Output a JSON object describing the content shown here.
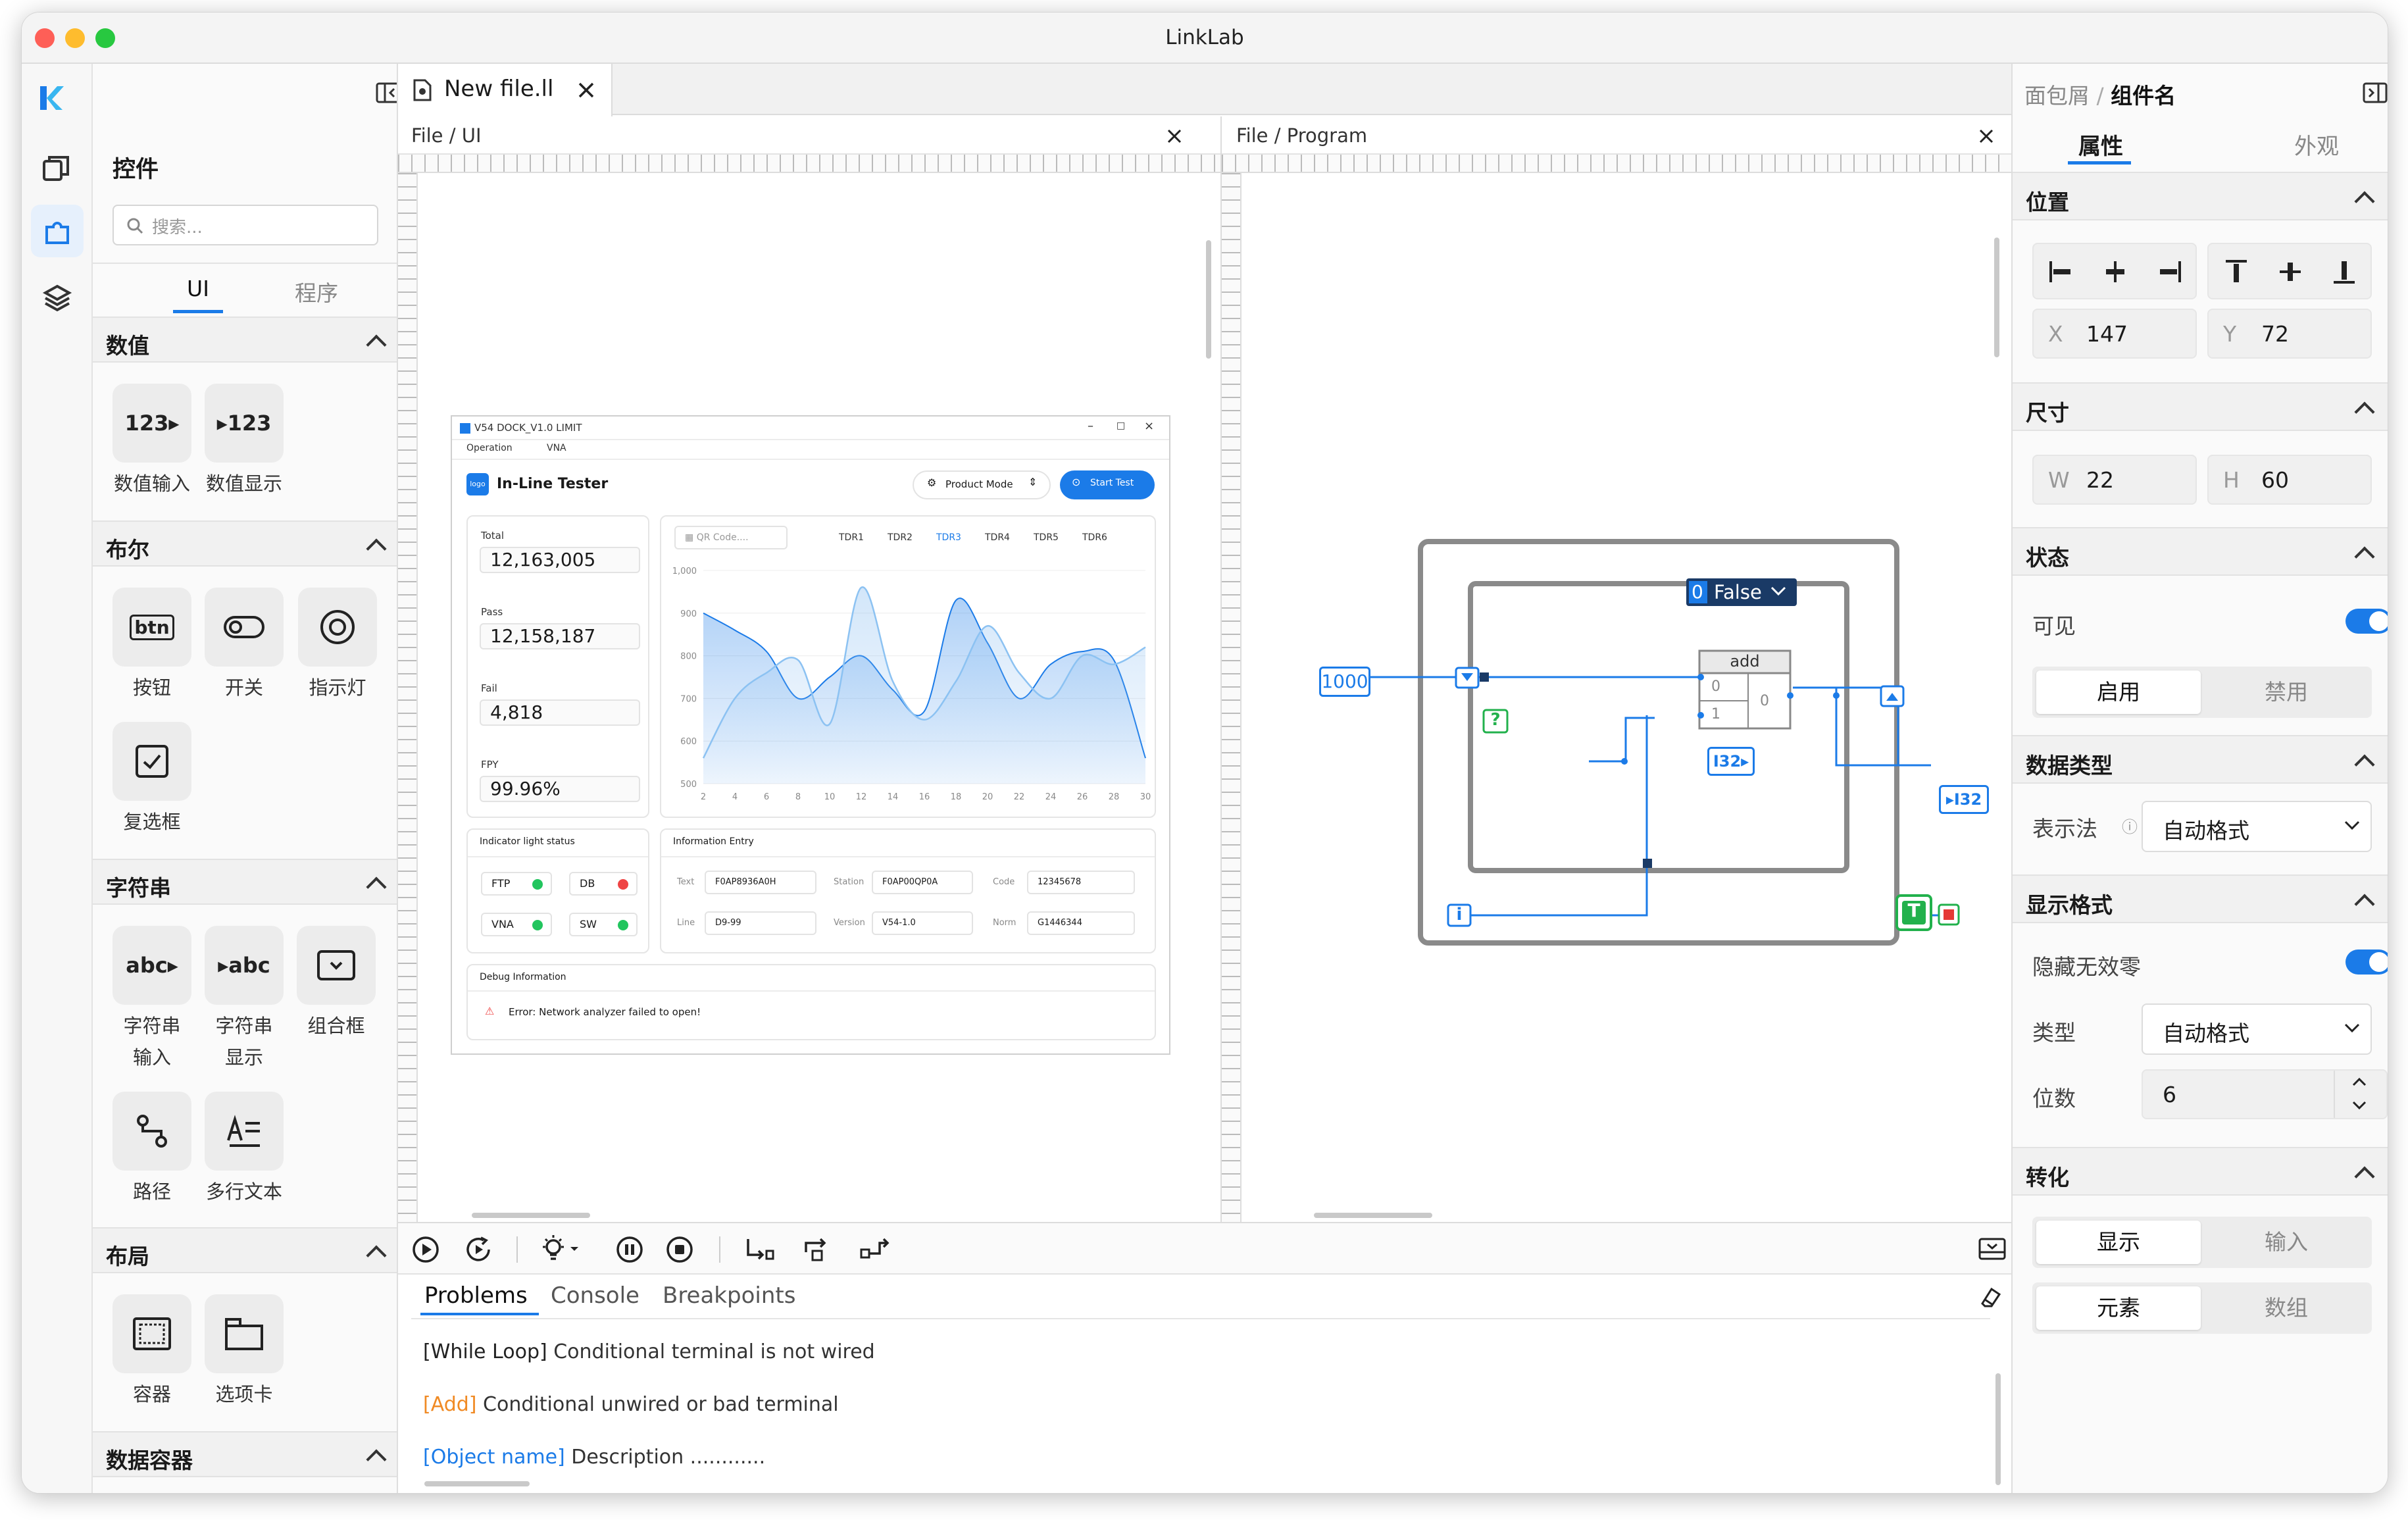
{
  "window": {
    "title": "LinkLab"
  },
  "left_panel": {
    "title": "控件",
    "search_placeholder": "搜索...",
    "tabs": [
      {
        "label": "UI",
        "active": true
      },
      {
        "label": "程序",
        "active": false
      }
    ],
    "sections": {
      "numeric": {
        "title": "数值",
        "items": [
          {
            "glyph": "123▸",
            "label": "数值输入"
          },
          {
            "glyph": "▸123",
            "label": "数值显示"
          }
        ]
      },
      "boolean": {
        "title": "布尔",
        "items": [
          {
            "glyph": "btn",
            "label": "按钮"
          },
          {
            "label": "开关"
          },
          {
            "label": "指示灯"
          },
          {
            "label": "复选框"
          }
        ]
      },
      "string": {
        "title": "字符串",
        "items": [
          {
            "glyph": "abc▸",
            "label_l1": "字符串",
            "label_l2": "输入"
          },
          {
            "glyph": "▸abc",
            "label_l1": "字符串",
            "label_l2": "显示"
          },
          {
            "label": "组合框"
          },
          {
            "label": "路径"
          },
          {
            "label": "多行文本"
          }
        ]
      },
      "layout": {
        "title": "布局",
        "items": [
          {
            "label": "容器"
          },
          {
            "label": "选项卡"
          }
        ]
      },
      "data_container": {
        "title": "数据容器"
      }
    }
  },
  "doc_tab": {
    "label": "New file.ll"
  },
  "ui_pane": {
    "breadcrumb": "File / UI",
    "preview": {
      "window_title": "V54 DOCK_V1.0 LIMIT",
      "menu": [
        "Operation",
        "VNA"
      ],
      "logo_text": "logo",
      "app_title": "In-Line Tester",
      "mode_label": "Product Mode",
      "start_label": "Start Test",
      "stats": [
        {
          "label": "Total",
          "value": "12,163,005"
        },
        {
          "label": "Pass",
          "value": "12,158,187"
        },
        {
          "label": "Fail",
          "value": "4,818"
        },
        {
          "label": "FPY",
          "value": "99.96%"
        }
      ],
      "qr_placeholder": "QR Code....",
      "tdr_tabs": [
        "TDR1",
        "TDR2",
        "TDR3",
        "TDR4",
        "TDR5",
        "TDR6"
      ],
      "tdr_active_index": 2,
      "indicator_title": "Indicator light status",
      "indicators": [
        {
          "label": "FTP",
          "color": "#22c55e"
        },
        {
          "label": "DB",
          "color": "#ef4444"
        },
        {
          "label": "VNA",
          "color": "#22c55e"
        },
        {
          "label": "SW",
          "color": "#22c55e"
        }
      ],
      "info_title": "Information Entry",
      "info": {
        "text_label": "Text",
        "text_value": "F0AP8936A0H",
        "station_label": "Station",
        "station_value": "F0AP00QP0A",
        "code_label": "Code",
        "code_value": "12345678",
        "line_label": "Line",
        "line_value": "D9-99",
        "version_label": "Version",
        "version_value": "V54-1.0",
        "norm_label": "Norm",
        "norm_value": "G1446344"
      },
      "debug_title": "Debug Information",
      "debug_error": "Error: Network analyzer failed to open!"
    }
  },
  "chart_data": {
    "type": "area",
    "title": "",
    "x": [
      2,
      4,
      6,
      8,
      10,
      12,
      14,
      16,
      18,
      20,
      22,
      24,
      26,
      28,
      30
    ],
    "xticks": [
      "2",
      "4",
      "6",
      "8",
      "10",
      "12",
      "14",
      "16",
      "18",
      "20",
      "22",
      "24",
      "26",
      "28",
      "30"
    ],
    "yticks": [
      "500",
      "600",
      "700",
      "800",
      "900",
      "1,000"
    ],
    "ylim": [
      500,
      1000
    ],
    "series": [
      {
        "values": [
          560,
          700,
          760,
          790,
          640,
          960,
          740,
          650,
          740,
          870,
          760,
          700,
          800,
          780,
          820
        ]
      },
      {
        "values": [
          900,
          860,
          810,
          700,
          750,
          800,
          720,
          670,
          930,
          830,
          700,
          780,
          810,
          790,
          560
        ]
      }
    ]
  },
  "program_pane": {
    "breadcrumb": "File / Program",
    "nodes": {
      "const_value": "1000",
      "case_selector": "0",
      "case_label": "False",
      "add_label": "add",
      "add_in0": "0",
      "add_in1": "1",
      "add_out": "0",
      "i32_in": "I32▸",
      "i32_out": "▸I32",
      "question": "?",
      "index": "i",
      "true_const": "T"
    }
  },
  "toolbar": {
    "icons": [
      "run-icon",
      "run-continuous-icon",
      "highlight-icon",
      "pause-icon",
      "stop-icon",
      "step-into-icon",
      "step-over-icon",
      "step-out-icon"
    ]
  },
  "bottom_panel": {
    "tabs": [
      {
        "label": "Problems",
        "active": true
      },
      {
        "label": "Console"
      },
      {
        "label": "Breakpoints"
      }
    ],
    "messages": [
      {
        "tag": "[While Loop]",
        "text": "Conditional terminal is not wired",
        "tag_color": "#222222"
      },
      {
        "tag": "[Add]",
        "text": "Conditional unwired or bad terminal",
        "tag_color": "#f08a24"
      },
      {
        "tag": "[Object name]",
        "text": "Description ............",
        "tag_color": "#1b7be8"
      }
    ]
  },
  "right_panel": {
    "breadcrumb_parent": "面包屑",
    "breadcrumb_sep": "/",
    "breadcrumb_current": "组件名",
    "tabs": [
      {
        "label": "属性",
        "active": true
      },
      {
        "label": "外观",
        "active": false
      }
    ],
    "position": {
      "title": "位置",
      "x_label": "X",
      "x_value": "147",
      "y_label": "Y",
      "y_value": "72"
    },
    "size": {
      "title": "尺寸",
      "w_label": "W",
      "w_value": "22",
      "h_label": "H",
      "h_value": "60"
    },
    "state": {
      "title": "状态",
      "visible_label": "可见",
      "visible_on": true,
      "enable_label": "启用",
      "disable_label": "禁用"
    },
    "data_type": {
      "title": "数据类型",
      "repr_label": "表示法",
      "repr_value": "自动格式"
    },
    "display_format": {
      "title": "显示格式",
      "hide_zeros_label": "隐藏无效零",
      "hide_zeros_on": true,
      "type_label": "类型",
      "type_value": "自动格式",
      "digits_label": "位数",
      "digits_value": "6"
    },
    "convert": {
      "title": "转化",
      "display_label": "显示",
      "input_label": "输入",
      "element_label": "元素",
      "array_label": "数组"
    }
  },
  "colors": {
    "accent": "#1b7be8",
    "error": "#ef4444",
    "warning": "#f08a24",
    "success": "#22c55e"
  }
}
